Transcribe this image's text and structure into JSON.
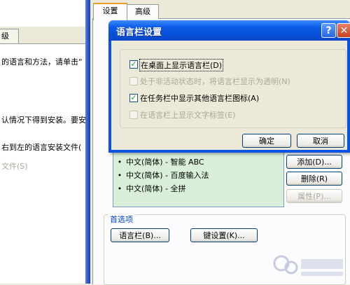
{
  "left_window": {
    "tab_label": "级",
    "line1": "的语言和方法，请单击“",
    "line2": "认情况下得到安装。要安",
    "line3": "右到左的语言安装文件(",
    "line4": "文件(S)"
  },
  "right_window": {
    "tabs": [
      "设置",
      "高级"
    ],
    "language_list": [
      "中文(简体) - 智能 ABC",
      "中文(简体) - 百度输入法",
      "中文(简体) - 全拼"
    ],
    "buttons": {
      "add": "添加(D)...",
      "remove": "删除(R)",
      "properties": "属性(P)..."
    },
    "preferences": {
      "legend": "首选项",
      "language_bar_button": "语言栏(B)...",
      "key_settings_button": "键设置(K)..."
    }
  },
  "dialog": {
    "title": "语言栏设置",
    "help_glyph": "?",
    "close_glyph": "✕",
    "options": [
      {
        "label": "在桌面上显示语言栏(D)",
        "checked": true,
        "enabled": true
      },
      {
        "label": "处于非活动状态时，将语言栏显示为透明(N)",
        "checked": false,
        "enabled": false
      },
      {
        "label": "在任务栏中显示其他语言栏图标(A)",
        "checked": true,
        "enabled": true
      },
      {
        "label": "在语言栏上显示文字标签(E)",
        "checked": false,
        "enabled": false
      }
    ],
    "ok_label": "确定",
    "cancel_label": "取消"
  },
  "colors": {
    "titlebar": "#0a53e0",
    "list_background": "#d9efd9",
    "accent_link": "#0046d5"
  }
}
